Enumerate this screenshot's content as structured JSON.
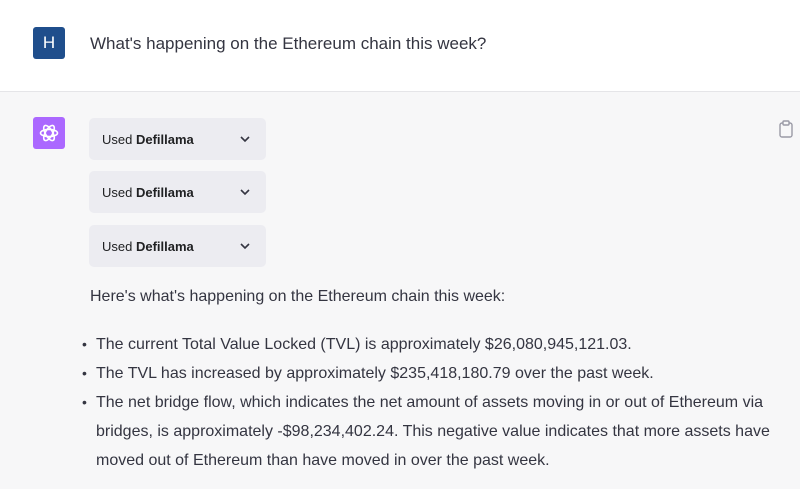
{
  "user_message": {
    "avatar_letter": "H",
    "text": "What's happening on the Ethereum chain this week?"
  },
  "assistant_message": {
    "plugin_chips": [
      {
        "prefix": "Used",
        "name": "Defillama"
      },
      {
        "prefix": "Used",
        "name": "Defillama"
      },
      {
        "prefix": "Used",
        "name": "Defillama"
      }
    ],
    "intro": "Here's what's happening on the Ethereum chain this week:",
    "bullets": [
      "The current Total Value Locked (TVL) is approximately $26,080,945,121.03.",
      "The TVL has increased by approximately $235,418,180.79 over the past week.",
      "The net bridge flow, which indicates the net amount of assets moving in or out of Ethereum via bridges, is approximately -$98,234,402.24. This negative value indicates that more assets have moved out of Ethereum than have moved in over the past week."
    ]
  },
  "colors": {
    "user_avatar": "#1f4e8c",
    "assistant_avatar": "#ab68ff",
    "assistant_bg": "#f7f7f8",
    "chip_bg": "#ececf1"
  },
  "icons": {
    "assistant_avatar": "openai-logo-icon",
    "copy": "clipboard-icon",
    "chip_toggle": "chevron-down-icon"
  }
}
